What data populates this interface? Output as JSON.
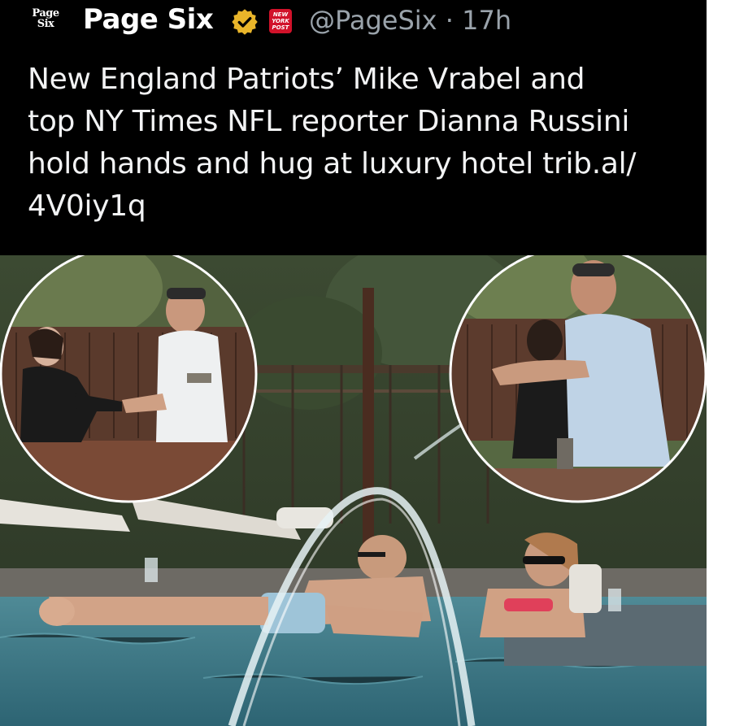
{
  "tweet": {
    "logo_line1": "Page",
    "logo_line2": "Six",
    "display_name": "Page Six",
    "affiliate_badge_line1": "NEW",
    "affiliate_badge_line2": "YORK",
    "affiliate_badge_line3": "POST",
    "handle": "@PageSix",
    "separator": "·",
    "time": "17h",
    "text_lines": [
      "New England Patriots’ Mike Vrabel and",
      "top NY Times NFL reporter Dianna Russini",
      "hold hands and hug at luxury hotel trib.al/",
      "4V0iy1q"
    ]
  },
  "icons": {
    "verified": "verified-badge-icon",
    "affiliate": "new-york-post-badge"
  },
  "colors": {
    "background": "#000000",
    "text": "#e7e9ea",
    "secondary_text": "#9aa3ab",
    "verified_gold": "#e9b52a",
    "affiliate_red": "#d1122a"
  }
}
